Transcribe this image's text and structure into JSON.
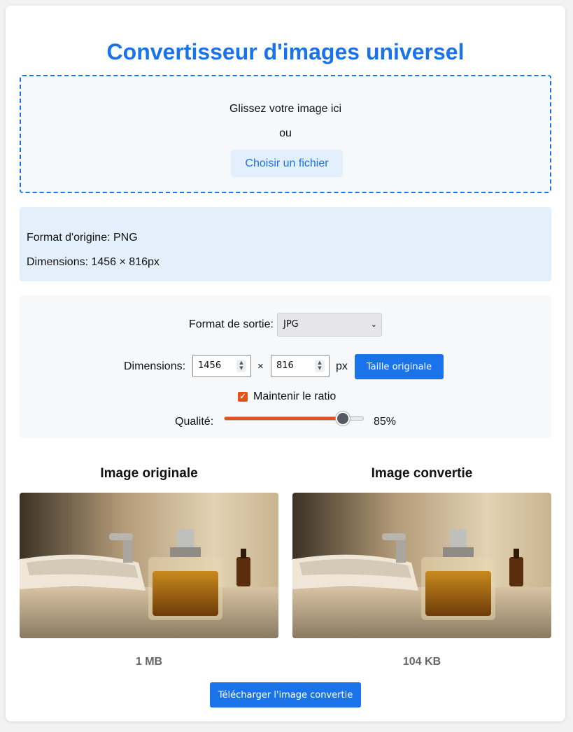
{
  "title": "Convertisseur d'images universel",
  "dropzone": {
    "text": "Glissez votre image ici",
    "or": "ou",
    "choose_button": "Choisir un fichier"
  },
  "info": {
    "format": "Format d'origine: PNG",
    "dimensions": "Dimensions: 1456 × 816px"
  },
  "settings": {
    "format_label": "Format de sortie:",
    "format_value": "JPG",
    "dimensions_label": "Dimensions:",
    "width": "1456",
    "times": "×",
    "height": "816",
    "unit": "px",
    "original_size_button": "Taille originale",
    "keep_ratio_label": "Maintenir le ratio",
    "keep_ratio_checked": true,
    "quality_label": "Qualité:",
    "quality_value": 85,
    "quality_text": "85%"
  },
  "preview": {
    "original_title": "Image originale",
    "converted_title": "Image convertie",
    "original_size": "1 MB",
    "converted_size": "104 KB"
  },
  "download_button": "Télécharger l'image convertie",
  "colors": {
    "accent": "#1a73e8",
    "slider": "#e8501a"
  }
}
